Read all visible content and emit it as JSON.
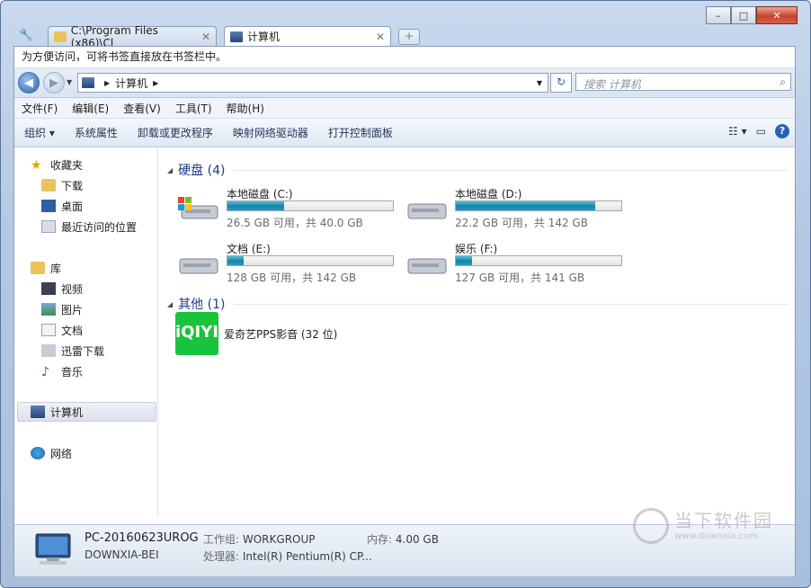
{
  "window": {
    "min": "–",
    "max": "□",
    "close": "✕"
  },
  "tabs": [
    {
      "label": "C:\\Program Files (x86)\\Cl",
      "close": "✕"
    },
    {
      "label": "计算机",
      "close": "✕"
    }
  ],
  "new_tab": "+",
  "bookmark_bar": {
    "text": "为方便访问，可将书签直接放在书签栏中。"
  },
  "address": {
    "crumb": "计算机",
    "search_placeholder": "搜索 计算机",
    "search_icon": "⌕",
    "refresh_icon": "↻"
  },
  "menu": [
    "文件(F)",
    "编辑(E)",
    "查看(V)",
    "工具(T)",
    "帮助(H)"
  ],
  "commands": [
    "组织 ▾",
    "系统属性",
    "卸载或更改程序",
    "映射网络驱动器",
    "打开控制面板"
  ],
  "help_icon": "?",
  "nav": {
    "favorites": "收藏夹",
    "fav_items": [
      "下载",
      "桌面",
      "最近访问的位置"
    ],
    "library": "库",
    "lib_items": [
      "视频",
      "图片",
      "文档",
      "迅雷下载",
      "音乐"
    ],
    "computer": "计算机",
    "network": "网络"
  },
  "groups": {
    "drives_title": "硬盘 (4)",
    "other_title": "其他 (1)"
  },
  "drives": [
    {
      "name": "本地磁盘 (C:)",
      "size": "26.5 GB 可用，共 40.0 GB",
      "used_fraction": 0.34
    },
    {
      "name": "本地磁盘 (D:)",
      "size": "22.2 GB 可用，共 142 GB",
      "used_fraction": 0.84
    },
    {
      "name": "文档 (E:)",
      "size": "128 GB 可用，共 142 GB",
      "used_fraction": 0.1
    },
    {
      "name": "娱乐 (F:)",
      "size": "127 GB 可用，共 141 GB",
      "used_fraction": 0.1
    }
  ],
  "other_item": {
    "logo_text": "iQIYI",
    "label": "爱奇艺PPS影音 (32 位)"
  },
  "status": {
    "pc_name": "PC-20160623UROG",
    "domain": "DOWNXIA-BEI",
    "workgroup_key": "工作组:",
    "workgroup_val": "WORKGROUP",
    "memory_key": "内存:",
    "memory_val": "4.00 GB",
    "cpu_key": "处理器:",
    "cpu_val": "Intel(R) Pentium(R) CP..."
  },
  "watermark": {
    "text": "当下软件园",
    "url": "www.downxia.com"
  }
}
